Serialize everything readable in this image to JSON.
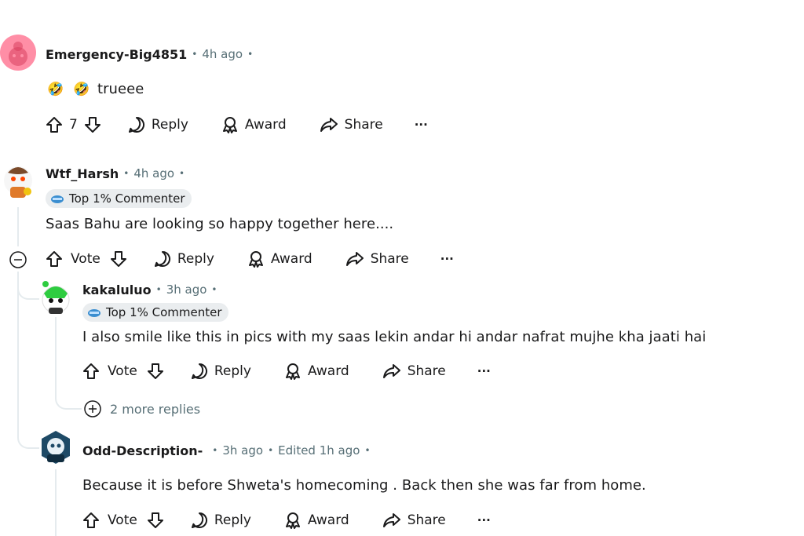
{
  "comments": [
    {
      "username": "Emergency-Big4851",
      "time": "4h ago",
      "emoji_reactions": [
        "🤣",
        "🤣"
      ],
      "text": "trueee",
      "vote_count": "7"
    },
    {
      "username": "Wtf_Harsh",
      "time": "4h ago",
      "flair": "Top 1% Commenter",
      "text": "Saas Bahu are looking so happy together here....",
      "vote_label": "Vote"
    },
    {
      "username": "kakaluluo",
      "time": "3h ago",
      "flair": "Top 1% Commenter",
      "text": "I also smile like this in pics with my saas lekin andar hi andar nafrat mujhe kha jaati hai",
      "vote_label": "Vote",
      "more_replies": "2 more replies"
    },
    {
      "username": "Odd-Description-",
      "time": "3h ago",
      "edited": "Edited 1h ago",
      "text": "Because it is before Shweta's homecoming . Back then she was far from home.",
      "vote_label": "Vote"
    }
  ],
  "actions": {
    "reply": "Reply",
    "award": "Award",
    "share": "Share",
    "more": "···"
  },
  "colors": {
    "meta": "#576f76",
    "thread_line": "#e5ebee",
    "flair_bg": "#eaedef",
    "avatar_pink": "#ff8ea6"
  },
  "icons": [
    "upvote-icon",
    "downvote-icon",
    "reply-bubble-icon",
    "award-icon",
    "share-icon",
    "more-dots-icon",
    "collapse-minus-icon",
    "expand-plus-icon",
    "top-commenter-icon"
  ]
}
